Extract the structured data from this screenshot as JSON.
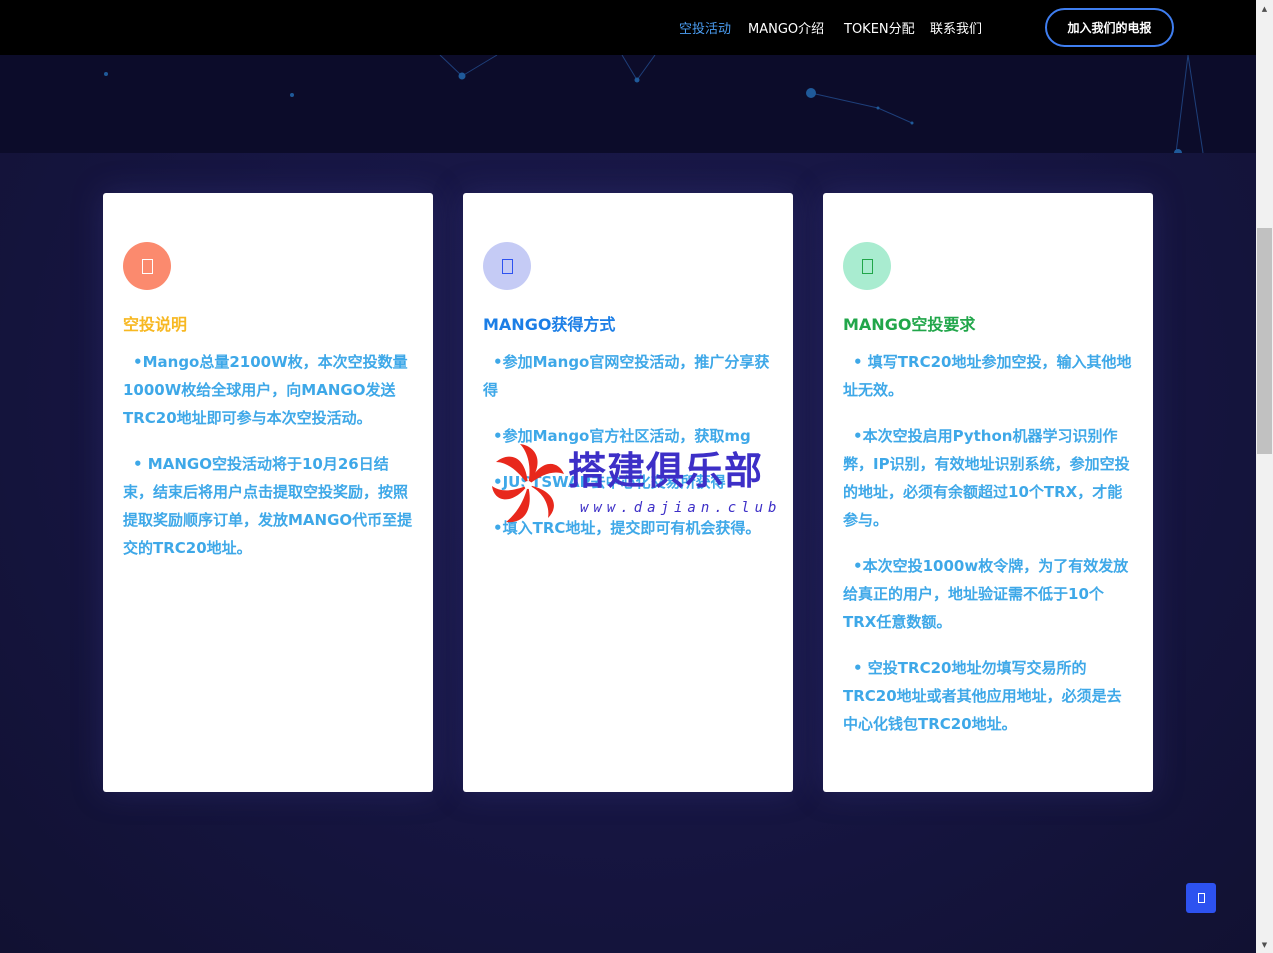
{
  "nav": {
    "links": [
      "空投活动",
      "MANGO介绍",
      "TOKEN分配",
      "联系我们"
    ],
    "join_label": "加入我们的电报"
  },
  "colors": {
    "accent": "#3f7ef0",
    "card1_icon": "#fb8a6e",
    "card2_icon": "#c5cbf5",
    "card3_icon": "#a9ecd0",
    "card1_title": "#f7b822",
    "card2_title": "#1b7ee6",
    "card3_title": "#21a64a",
    "body_text": "#3ea8e8"
  },
  "cards": [
    {
      "icon": "doc-icon",
      "title": "空投说明",
      "paragraphs": [
        "•Mango总量2100W枚，本次空投数量1000W枚给全球用户，向MANGO发送TRC20地址即可参与本次空投活动。",
        "• MANGO空投活动将于10月26日结束，结束后将用户点击提取空投奖励，按照提取奖励顺序订单，发放MANGO代币至提交的TRC20地址。"
      ]
    },
    {
      "icon": "doc-icon",
      "title": "MANGO获得方式",
      "paragraphs": [
        "•参加Mango官网空投活动，推广分享获得",
        "•参加Mango官方社区活动，获取mg",
        "•JUSTSWAP去中心化交易所获得",
        "•填入TRC地址，提交即可有机会获得。"
      ]
    },
    {
      "icon": "doc-icon",
      "title": "MANGO空投要求",
      "paragraphs": [
        "• 填写TRC20地址参加空投，输入其他地址无效。",
        "•本次空投启用Python机器学习识别作弊，IP识别，有效地址识别系统，参加空投的地址，必须有余额超过10个TRX，才能参与。",
        "•本次空投1000w枚令牌，为了有效发放给真正的用户，地址验证需不低于10个TRX任意数额。",
        "• 空投TRC20地址勿填写交易所的TRC20地址或者其他应用地址，必须是去中心化钱包TRC20地址。"
      ]
    }
  ],
  "watermark": {
    "text": "搭建俱乐部",
    "url": "www.dajian.club"
  }
}
